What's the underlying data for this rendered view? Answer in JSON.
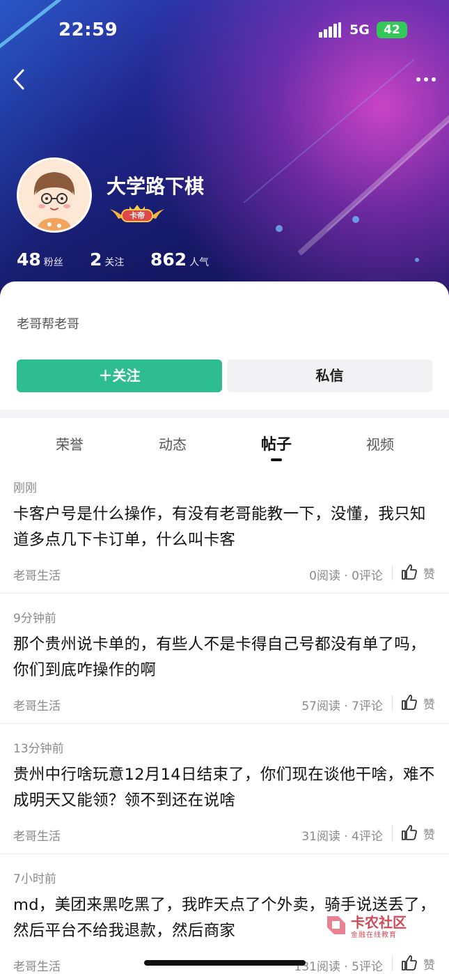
{
  "status_bar": {
    "time": "22:59",
    "network": "5G",
    "battery": "42"
  },
  "profile": {
    "username": "大学路下棋",
    "rank_badge": "卡帝",
    "stats": [
      {
        "value": "48",
        "label": "粉丝"
      },
      {
        "value": "2",
        "label": "关注"
      },
      {
        "value": "862",
        "label": "人气"
      }
    ],
    "bio": "老哥帮老哥",
    "follow_label": "＋关注",
    "message_label": "私信"
  },
  "tabs": [
    {
      "label": "荣誉",
      "active": false
    },
    {
      "label": "动态",
      "active": false
    },
    {
      "label": "帖子",
      "active": true
    },
    {
      "label": "视频",
      "active": false
    }
  ],
  "posts": [
    {
      "time": "刚刚",
      "title": "卡客户号是什么操作，有没有老哥能教一下，没懂，我只知道多点几下卡订单，什么叫卡客",
      "category": "老哥生活",
      "stats": "0阅读 · 0评论",
      "like_label": "赞"
    },
    {
      "time": "9分钟前",
      "title": "那个贵州说卡单的，有些人不是卡得自己号都没有单了吗，你们到底咋操作的啊",
      "category": "老哥生活",
      "stats": "57阅读 · 7评论",
      "like_label": "赞"
    },
    {
      "time": "13分钟前",
      "title": "贵州中行啥玩意12月14日结束了，你们现在谈他干啥，难不成明天又能领？领不到还在说啥",
      "category": "老哥生活",
      "stats": "31阅读 · 4评论",
      "like_label": "赞"
    },
    {
      "time": "7小时前",
      "title": "md，美团来黑吃黑了，我昨天点了个外卖，骑手说送丢了，然后平台不给我退款，然后商家",
      "category": "老哥生活",
      "stats": "131阅读 · 5评论",
      "like_label": "赞"
    }
  ],
  "watermark": {
    "title": "卡农社区",
    "subtitle": "金融在线教育"
  },
  "colors": {
    "accent": "#2ebc91",
    "hero_start": "#2a2f9e",
    "hero_pink": "#d246c8"
  }
}
